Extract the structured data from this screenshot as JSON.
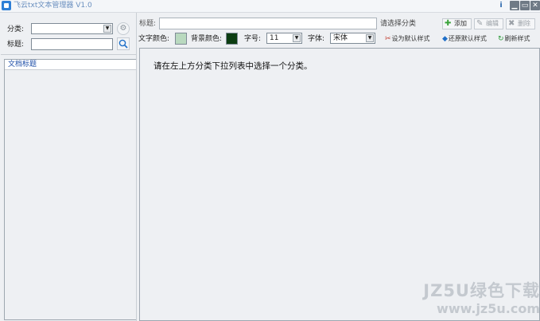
{
  "window": {
    "title": "飞云txt文本管理器 V1.0",
    "controls": {
      "info": "i",
      "minimize": "▁",
      "maximize": "▭",
      "close": "✕"
    }
  },
  "sidebar": {
    "category_label": "分类:",
    "category_value": "",
    "title_label": "标题:",
    "title_value": "",
    "list_header": "文档标题",
    "items": []
  },
  "toolbar": {
    "title_label": "标题:",
    "title_value": "",
    "category_hint": "请选择分类",
    "add_label": "添加",
    "edit_label": "编辑",
    "delete_label": "删除",
    "text_color_label": "文字颜色:",
    "text_color": "#b9d9bf",
    "bg_color_label": "背景颜色:",
    "bg_color": "#0c3d12",
    "font_size_label": "字号:",
    "font_size_value": "11",
    "font_family_label": "字体:",
    "font_family_value": "宋体",
    "set_default_label": "设为默认样式",
    "restore_default_label": "还原默认样式",
    "refresh_style_label": "刷新样式"
  },
  "content": {
    "message": "请在左上方分类下拉列表中选择一个分类。"
  },
  "watermark": {
    "line1": "JZ5U绿色下载",
    "line2": "www.jz5u.com"
  }
}
